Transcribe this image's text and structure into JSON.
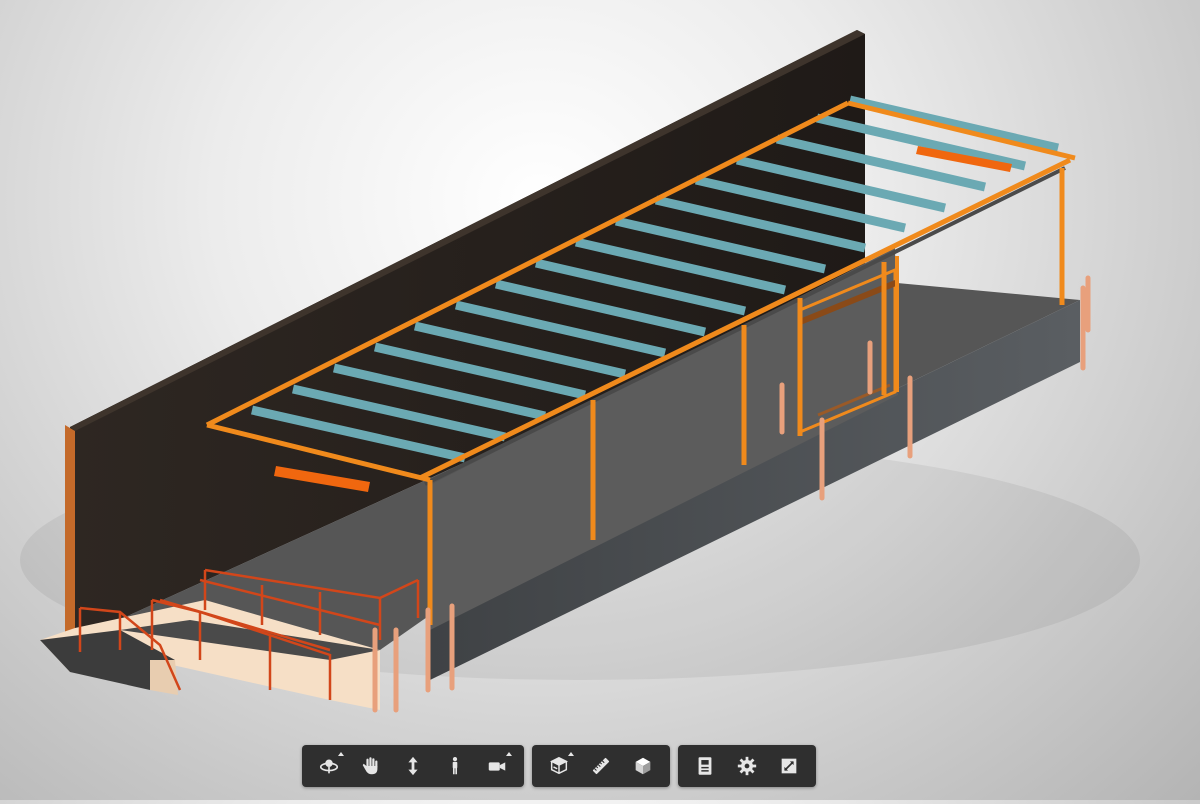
{
  "viewer": {
    "background": "#e8e8e8",
    "colors": {
      "wall": "#2a241f",
      "wall_edge": "#4a3f36",
      "slab_top": "#565656",
      "slab_side": "#4c5055",
      "steel_frame": "#f08a1c",
      "joists": "#6ba9b3",
      "railings": "#d2461a",
      "bollards": "#e8a07c",
      "ramp_stairs": "#f6dfc6"
    }
  },
  "toolbar": {
    "groups": [
      {
        "name": "navigation",
        "tools": [
          {
            "id": "orbit",
            "icon": "orbit-icon",
            "has_dropdown": true
          },
          {
            "id": "pan",
            "icon": "pan-hand-icon",
            "has_dropdown": false
          },
          {
            "id": "zoom",
            "icon": "zoom-arrows-icon",
            "has_dropdown": false
          },
          {
            "id": "first-person",
            "icon": "person-icon",
            "has_dropdown": false
          },
          {
            "id": "camera",
            "icon": "camera-icon",
            "has_dropdown": true
          }
        ]
      },
      {
        "name": "model-tools",
        "tools": [
          {
            "id": "section",
            "icon": "section-box-icon",
            "has_dropdown": true
          },
          {
            "id": "measure",
            "icon": "ruler-icon",
            "has_dropdown": false
          },
          {
            "id": "explode",
            "icon": "cube-icon",
            "has_dropdown": false
          }
        ]
      },
      {
        "name": "settings",
        "tools": [
          {
            "id": "properties",
            "icon": "properties-icon",
            "has_dropdown": false
          },
          {
            "id": "settings",
            "icon": "gear-icon",
            "has_dropdown": false
          },
          {
            "id": "fullscreen",
            "icon": "fullscreen-icon",
            "has_dropdown": false
          }
        ]
      }
    ]
  }
}
